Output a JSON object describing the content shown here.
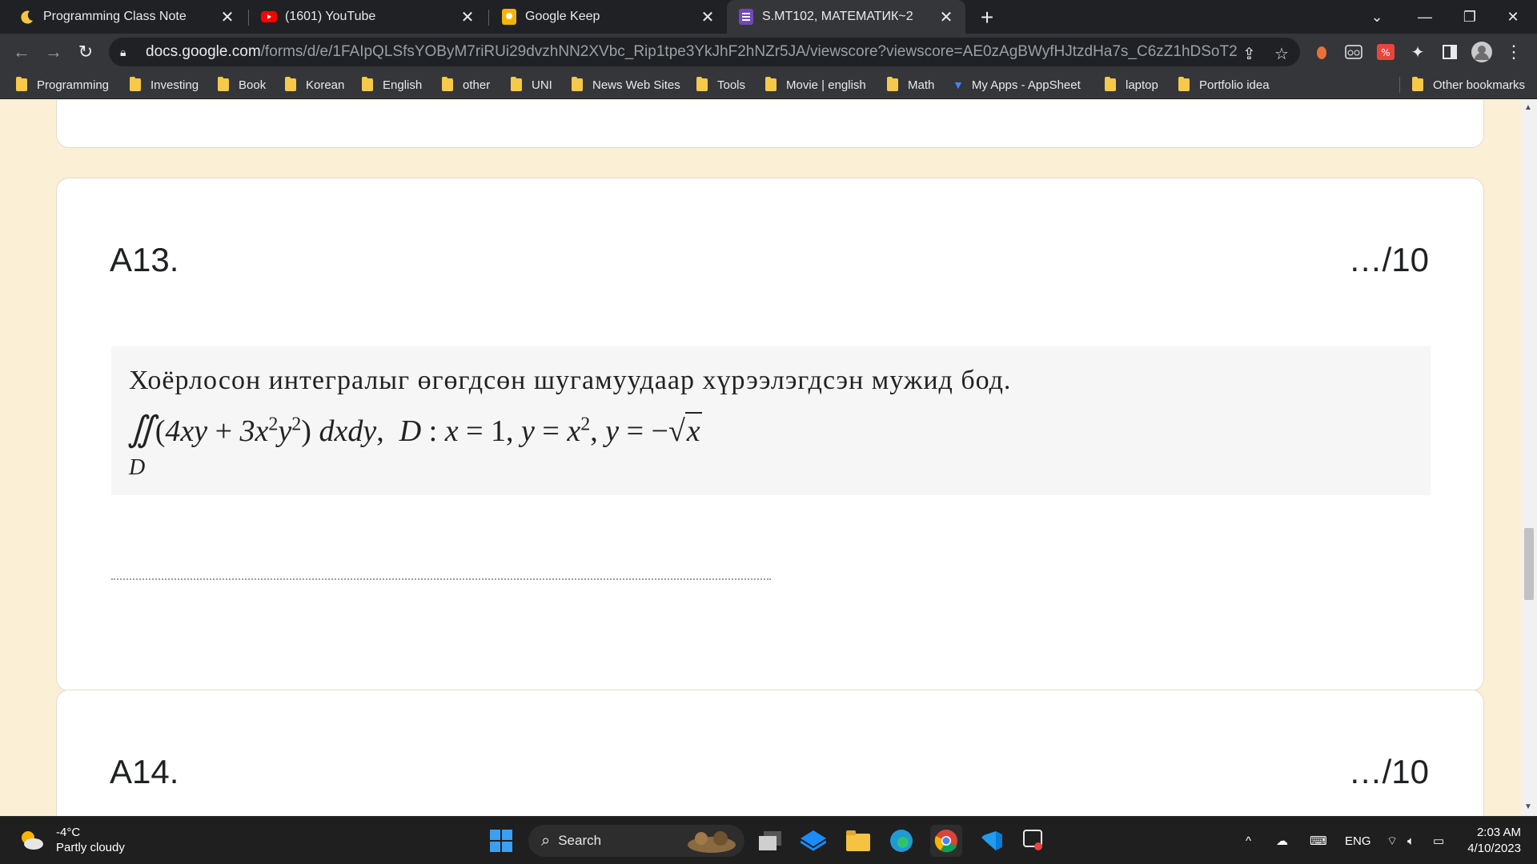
{
  "tabs": [
    {
      "title": "Programming Class Note",
      "icon": "moon-icon"
    },
    {
      "title": "(1601) YouTube",
      "icon": "youtube-icon"
    },
    {
      "title": "Google Keep",
      "icon": "keep-icon"
    },
    {
      "title": "S.MT102, МАТЕМАТИК~2",
      "icon": "forms-icon",
      "active": true
    }
  ],
  "address_bar": {
    "host": "docs.google.com",
    "path": "/forms/d/e/1FAIpQLSfsYOByM7riRUi29dvzhNN2XVbc_Rip1tpe3YkJhF2hNZr5JA/viewscore?viewscore=AE0zAgBWyfHJtzdHa7s_C6zZ1hDSoT21PUOvxGWiMQK..."
  },
  "bookmarks": [
    "Programming",
    "Investing",
    "Book",
    "Korean",
    "English",
    "other",
    "UNI",
    "News Web Sites",
    "Tools",
    "Movie | english",
    "Math",
    "My Apps - AppSheet",
    "laptop",
    "Portfolio idea"
  ],
  "other_bookmarks": "Other bookmarks",
  "questions": [
    {
      "title": "A13.",
      "score": "…/10",
      "prompt": "Хоёрлосон интегралыг өгөгдсөн шугамуудаар хүрээлэгдсэн мужид бод.",
      "formula_region": "D"
    },
    {
      "title": "A14.",
      "score": "…/10"
    }
  ],
  "taskbar": {
    "weather_temp": "-4°C",
    "weather_desc": "Partly cloudy",
    "search_label": "Search",
    "language": "ENG",
    "time": "2:03 AM",
    "date": "4/10/2023"
  },
  "colors": {
    "page_background": "#fbefd6",
    "tab_bar": "#202124",
    "toolbar": "#35363a",
    "folder": "#f7c948"
  }
}
